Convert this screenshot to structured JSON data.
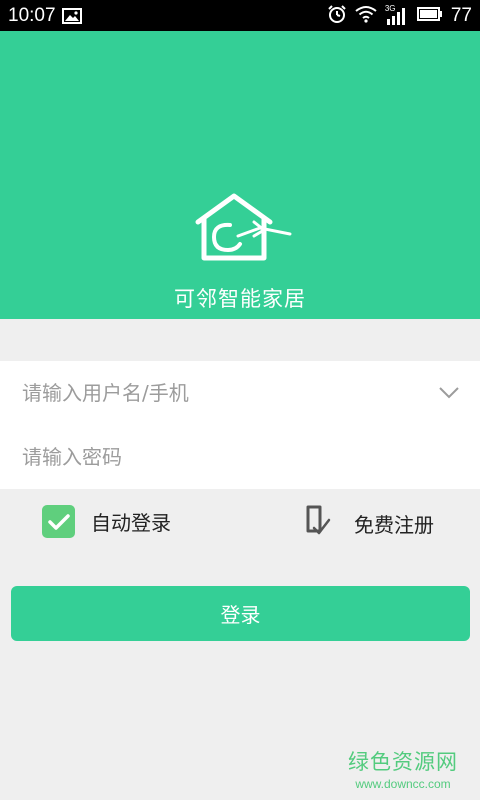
{
  "status_bar": {
    "time": "10:07",
    "network_label": "3G",
    "battery_level": "77"
  },
  "header": {
    "app_name": "可邻智能家居",
    "background_color": "#34cf96",
    "logo_icon": "house-logo-icon"
  },
  "form": {
    "username_placeholder": "请输入用户名/手机",
    "username_value": "",
    "password_placeholder": "请输入密码",
    "password_value": ""
  },
  "options": {
    "auto_login_label": "自动登录",
    "auto_login_checked": true,
    "register_label": "免费注册"
  },
  "actions": {
    "login_label": "登录"
  },
  "watermark": {
    "title": "绿色资源网",
    "url": "www.downcc.com"
  },
  "colors": {
    "accent": "#34cf96",
    "checkbox": "#5fcf7d",
    "background": "#efefef"
  }
}
